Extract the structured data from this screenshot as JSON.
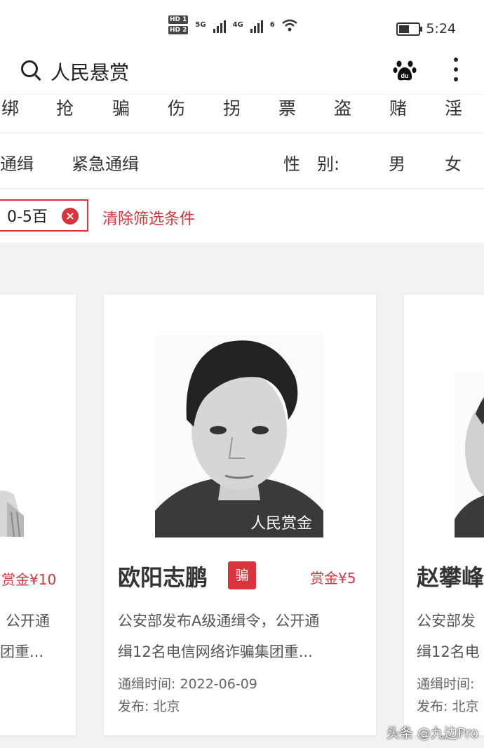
{
  "status_bar": {
    "hd1": "HD 1",
    "hd2": "HD 2",
    "net1": "5G",
    "net2": "4G",
    "wifi": "6",
    "time": "5:24"
  },
  "header": {
    "title": "人民悬赏",
    "search_icon": "search-icon",
    "baidu_icon": "baidu-paw-icon",
    "menu_icon": "more-vertical-icon"
  },
  "categories": [
    "绑",
    "抢",
    "骗",
    "伤",
    "拐",
    "票",
    "盗",
    "赌",
    "淫"
  ],
  "type_row": {
    "type1": "通缉",
    "type2": "紧急通缉",
    "gender_label": "性　别:",
    "male": "男",
    "female": "女"
  },
  "filter": {
    "chip_label": "0-5百",
    "clear_label": "清除筛选条件"
  },
  "cards": [
    {
      "reward": "赏金¥10",
      "desc1": "公开通",
      "desc2": "团重..."
    },
    {
      "name": "欧阳志鹏",
      "tag": "骗",
      "reward": "赏金¥5",
      "desc1": "公安部发布A级通缉令，公开通",
      "desc2": "缉12名电信网络诈骗集团重...",
      "time_label": "通缉时间:",
      "time_value": "2022-06-09",
      "publish_label": "发布:",
      "publish_value": "北京",
      "photo_watermark": "人民赏金"
    },
    {
      "name": "赵攀峰",
      "desc1": "公安部发",
      "desc2": "缉12名电",
      "time_label": "通缉时间:",
      "publish_label": "发布:",
      "publish_value": "北京"
    }
  ],
  "watermark": "头条 @九边Pro"
}
